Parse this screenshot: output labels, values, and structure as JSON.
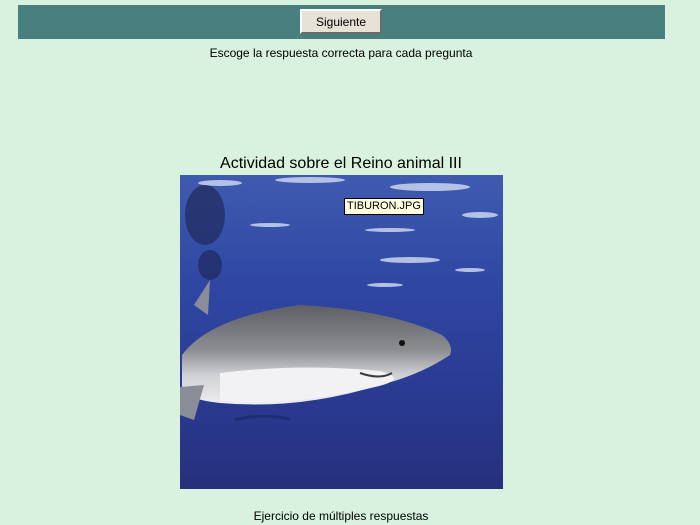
{
  "toolbar": {
    "next_label": "Siguiente"
  },
  "instructions": "Escoge la respuesta correcta para cada pregunta",
  "activity_title": "Actividad sobre el Reino animal III",
  "image": {
    "tooltip": "TIBURON.JPG"
  },
  "footer": "Ejercicio de múltiples respuestas",
  "colors": {
    "page_background": "#d8f2df",
    "top_bar": "#4a7f7f",
    "button_face": "#e7e2d6",
    "tooltip_background": "#ffffe1",
    "water": "#2c3c93"
  }
}
